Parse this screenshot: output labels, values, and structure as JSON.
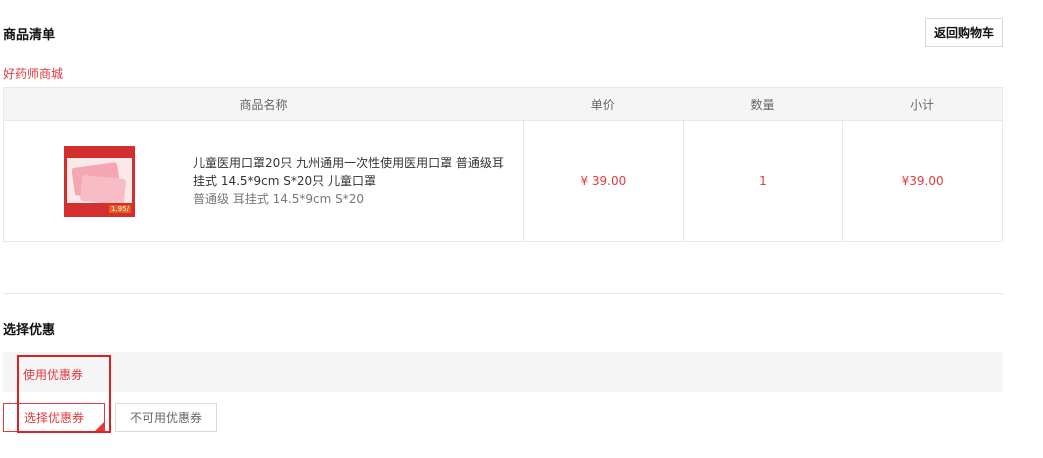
{
  "goods_section": {
    "title": "商品清单",
    "back_button": "返回购物车",
    "store_name": "好药师商城",
    "columns": [
      "商品名称",
      "单价",
      "数量",
      "小计"
    ],
    "items": [
      {
        "name": "儿童医用口罩20只 九州通用一次性使用医用口罩 普通级耳挂式 14.5*9cm S*20只 儿童口罩",
        "spec": "普通级 耳挂式 14.5*9cm S*20",
        "unit_price": "¥ 39.00",
        "quantity": "1",
        "subtotal": "¥39.00",
        "thumb_price_tag": "1.95/"
      }
    ]
  },
  "coupon_section": {
    "title": "选择优惠",
    "use_coupon_label": "使用优惠券",
    "tabs": [
      "选择优惠券",
      "不可用优惠券"
    ],
    "active_tab": "选择优惠券"
  },
  "colors": {
    "accent": "#e4393c",
    "header_bg": "#f5f5f5",
    "border": "#e8e8e8",
    "highlight_box": "#e02020"
  },
  "icons": [
    "tab-corner-check-icon"
  ]
}
